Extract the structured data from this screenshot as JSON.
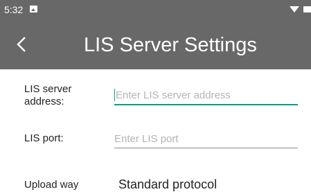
{
  "status_bar": {
    "time": "5:32",
    "icons": [
      "image-notification-icon",
      "wifi-icon",
      "battery-icon"
    ]
  },
  "app_bar": {
    "back_icon": "chevron-left-icon",
    "title": "LIS Server Settings",
    "background": "#686868"
  },
  "form": {
    "server_address": {
      "label": "LIS server address:",
      "value": "",
      "placeholder": "Enter LIS server address",
      "focused": true
    },
    "port": {
      "label": "LIS port:",
      "value": "",
      "placeholder": "Enter LIS port",
      "focused": false
    },
    "upload_way": {
      "label": "Upload way",
      "value": "Standard protocol"
    }
  },
  "colors": {
    "accent": "#00a088",
    "divider": "#8a8a8a",
    "bar": "#686868"
  }
}
